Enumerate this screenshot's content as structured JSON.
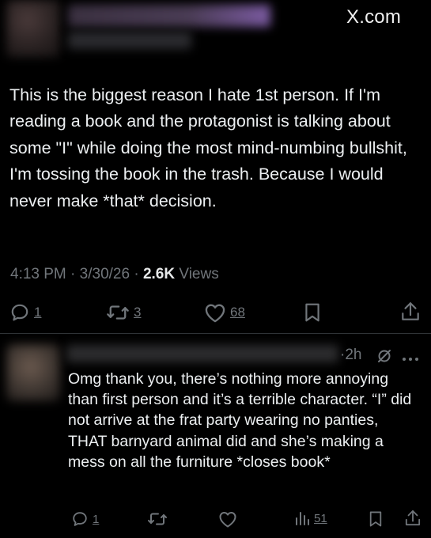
{
  "watermark": "X.com",
  "tweet": {
    "text": "This is the biggest reason I hate 1st person. If I'm reading a book and the protagonist is talking about some \"I\" while doing the most mind-numbing bullshit, I'm tossing the book in the trash. Because I would never make *that* decision.",
    "time": "4:13 PM",
    "date": "3/30/26",
    "views_count": "2.6K",
    "views_label": "Views",
    "replies": "1",
    "reposts": "3",
    "likes": "68"
  },
  "reply": {
    "time": "2h",
    "text": "Omg thank you, there’s nothing more annoying than first person and it’s a terrible character. “I” did not arrive at the frat party wearing no panties, THAT barnyard animal did and she’s making a mess on all the furniture *closes book*",
    "replies": "1",
    "views": "51"
  },
  "icons": {
    "reply": "speech-bubble-icon",
    "repost": "repost-icon",
    "like": "heart-icon",
    "bookmark": "bookmark-icon",
    "share": "share-icon",
    "views": "bar-chart-icon",
    "grok": "grok-icon",
    "more": "more-dots-icon"
  },
  "colors": {
    "background": "#000000",
    "text": "#e7e9ea",
    "muted": "#71767b"
  }
}
